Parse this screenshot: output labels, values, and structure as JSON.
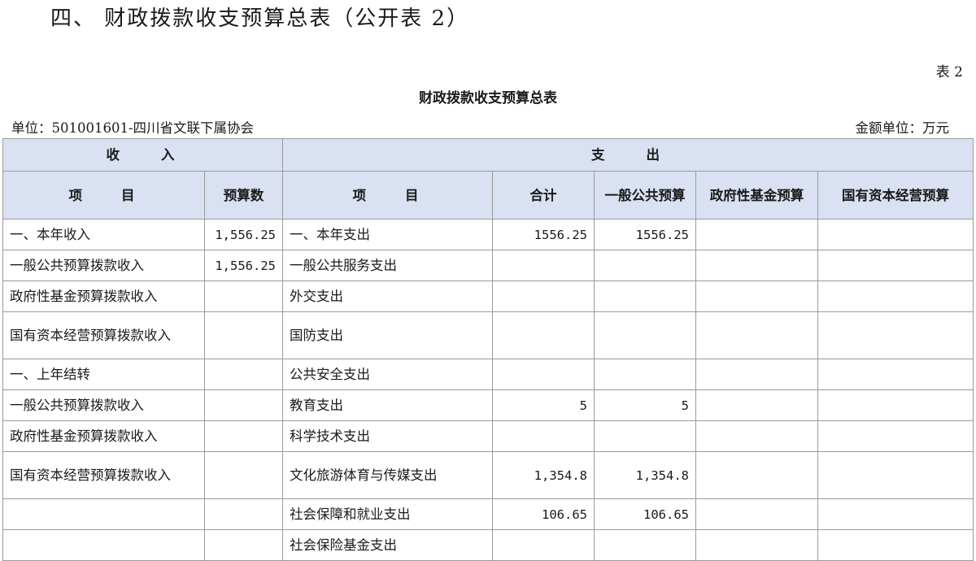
{
  "page": {
    "heading": "四、 财政拨款收支预算总表（公开表 2）",
    "table_no": "表 2",
    "table_title": "财政拨款收支预算总表",
    "unit_left": "单位：501001601-四川省文联下属协会",
    "unit_right": "金额单位：万元"
  },
  "header": {
    "income_group": "收　　入",
    "expense_group": "支　　出",
    "col_income_item": "项　　目",
    "col_income_budget": "预算数",
    "col_expense_item": "项　　目",
    "col_total": "合计",
    "col_general": "一般公共预算",
    "col_fund": "政府性基金预算",
    "col_state": "国有资本经营预算"
  },
  "rows": [
    {
      "income_item": "一、本年收入",
      "income_budget": "1,556.25",
      "expense_item": "一、本年支出",
      "total": "1556.25",
      "general": "1556.25",
      "fund": "",
      "state": ""
    },
    {
      "income_item": "一般公共预算拨款收入",
      "income_budget": "1,556.25",
      "expense_item": "一般公共服务支出",
      "total": "",
      "general": "",
      "fund": "",
      "state": ""
    },
    {
      "income_item": "政府性基金预算拨款收入",
      "income_budget": "",
      "expense_item": "外交支出",
      "total": "",
      "general": "",
      "fund": "",
      "state": ""
    },
    {
      "income_item": "国有资本经营预算拨款收入",
      "income_budget": "",
      "expense_item": "国防支出",
      "total": "",
      "general": "",
      "fund": "",
      "state": ""
    },
    {
      "income_item": "一、上年结转",
      "income_budget": "",
      "expense_item": "公共安全支出",
      "total": "",
      "general": "",
      "fund": "",
      "state": ""
    },
    {
      "income_item": "一般公共预算拨款收入",
      "income_budget": "",
      "expense_item": "教育支出",
      "total": "5",
      "general": "5",
      "fund": "",
      "state": ""
    },
    {
      "income_item": "政府性基金预算拨款收入",
      "income_budget": "",
      "expense_item": "科学技术支出",
      "total": "",
      "general": "",
      "fund": "",
      "state": ""
    },
    {
      "income_item": "国有资本经营预算拨款收入",
      "income_budget": "",
      "expense_item": "文化旅游体育与传媒支出",
      "total": "1,354.8",
      "general": "1,354.8",
      "fund": "",
      "state": ""
    },
    {
      "income_item": "",
      "income_budget": "",
      "expense_item": "社会保障和就业支出",
      "total": "106.65",
      "general": "106.65",
      "fund": "",
      "state": ""
    },
    {
      "income_item": "",
      "income_budget": "",
      "expense_item": "社会保险基金支出",
      "total": "",
      "general": "",
      "fund": "",
      "state": ""
    }
  ]
}
